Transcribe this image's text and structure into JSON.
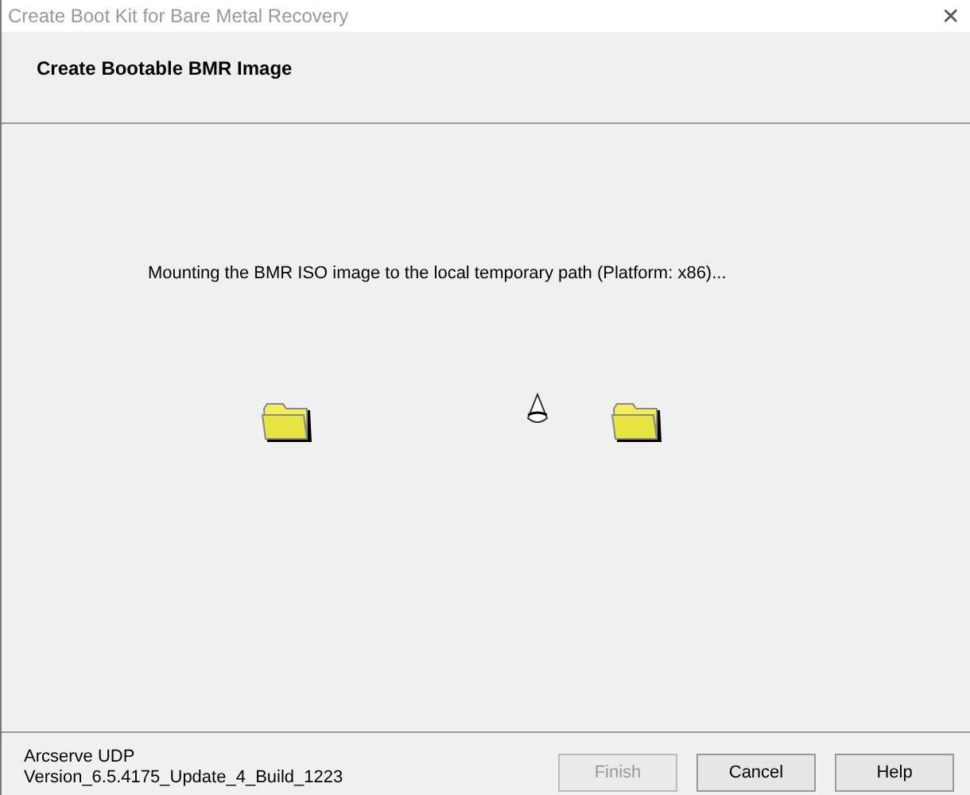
{
  "window": {
    "title": "Create Boot Kit for Bare Metal Recovery",
    "close": "✕"
  },
  "header": {
    "title": "Create Bootable BMR Image"
  },
  "body": {
    "message": "Mounting the BMR ISO image to the local temporary path (Platform: x86)..."
  },
  "footer": {
    "product": "Arcserve UDP",
    "version": "Version_6.5.4175_Update_4_Build_1223"
  },
  "buttons": [
    {
      "label": "Finish",
      "disabled": true
    },
    {
      "label": "Cancel",
      "disabled": false
    },
    {
      "label": "Help",
      "disabled": false
    }
  ]
}
